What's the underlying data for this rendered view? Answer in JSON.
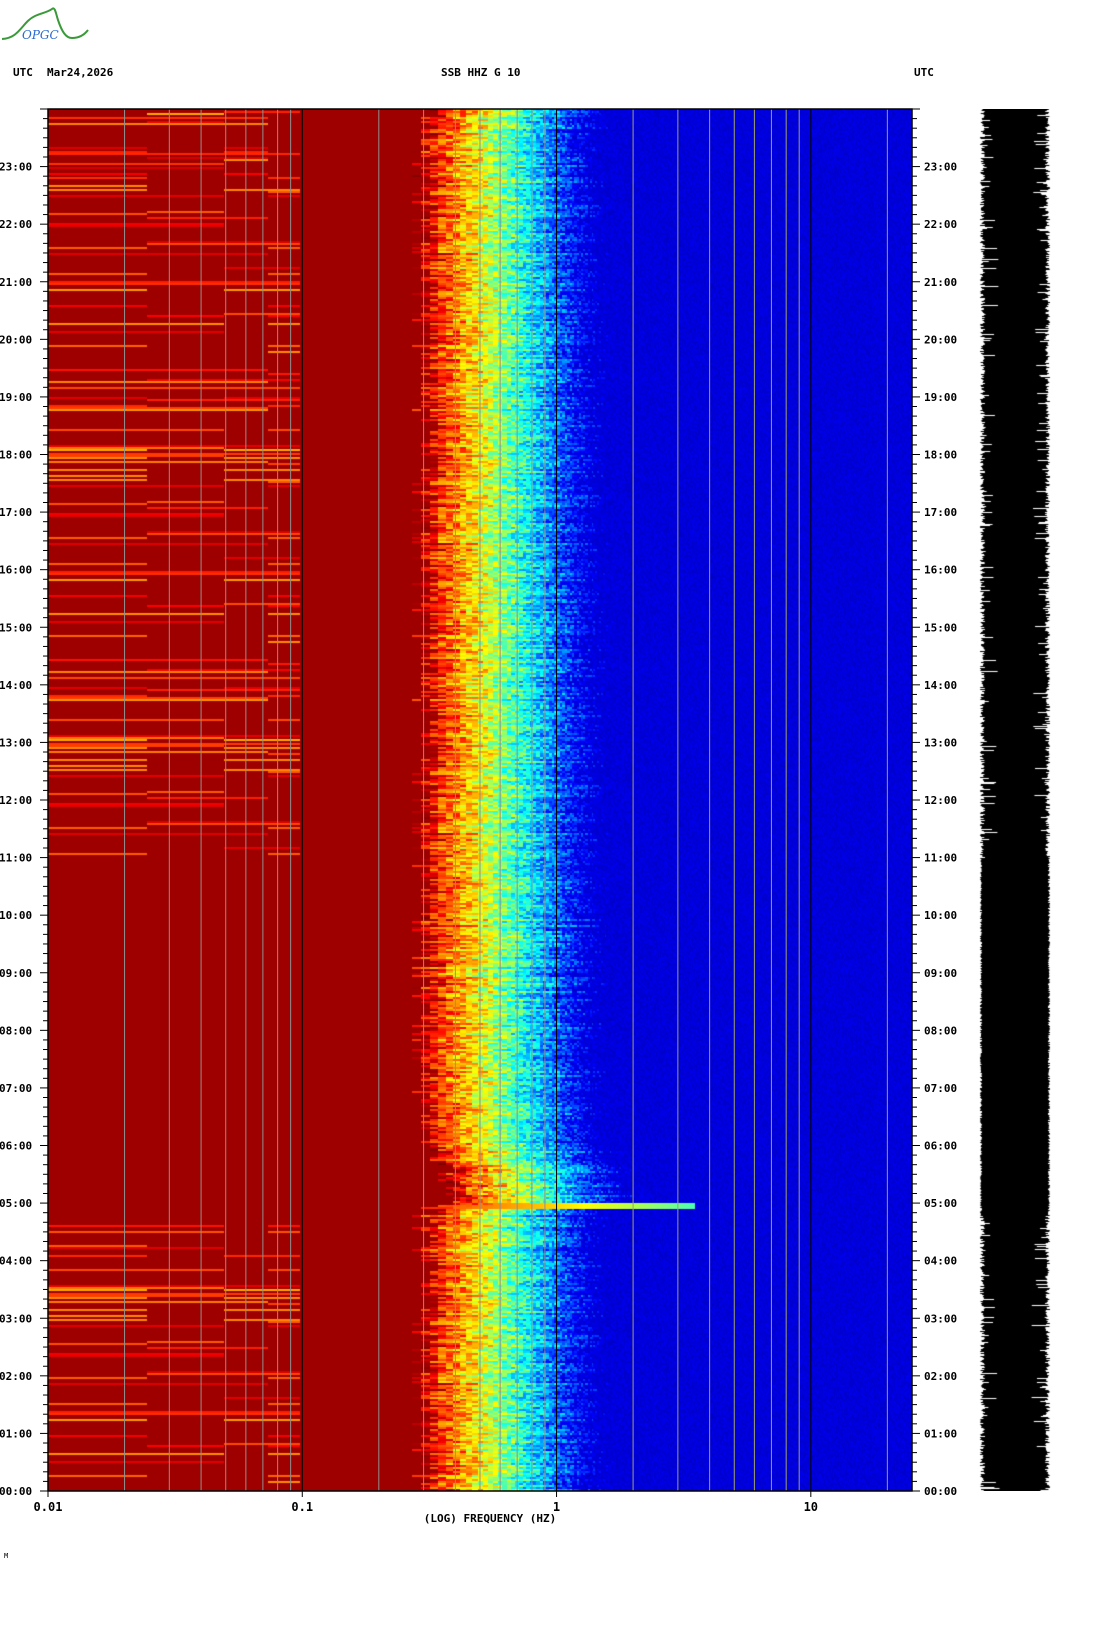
{
  "logo_text": "OPGC",
  "header": {
    "left_tz": "UTC",
    "date": "Mar24,2026",
    "station": "SSB HHZ G 10",
    "right_tz": "UTC"
  },
  "footer_mark": "M",
  "chart_data": {
    "type": "heatmap",
    "title": "SSB HHZ G 10",
    "xlabel": "(LOG) FREQUENCY (HZ)",
    "ylabel": "UTC",
    "x_scale": "log",
    "xlim": [
      0.01,
      25
    ],
    "x_ticks": [
      {
        "value": 0.01,
        "label": "0.01"
      },
      {
        "value": 0.1,
        "label": "0.1"
      },
      {
        "value": 1,
        "label": "1"
      },
      {
        "value": 10,
        "label": "10"
      }
    ],
    "ylim_hours": [
      0,
      24
    ],
    "y_ticks": [
      "00:00",
      "01:00",
      "02:00",
      "03:00",
      "04:00",
      "05:00",
      "06:00",
      "07:00",
      "08:00",
      "09:00",
      "10:00",
      "11:00",
      "12:00",
      "13:00",
      "14:00",
      "15:00",
      "16:00",
      "17:00",
      "18:00",
      "19:00",
      "20:00",
      "21:00",
      "22:00",
      "23:00"
    ],
    "colormap": "jet",
    "background_low_freq_color": "#880000",
    "background_high_freq_color": "#0000a8",
    "microseism_band_hz": [
      0.3,
      1.0
    ],
    "quiet_low_freq_period_hours": [
      4.8,
      11.0
    ],
    "event": {
      "time_hours": 4.95,
      "max_frequency_hz": 3.5
    }
  }
}
